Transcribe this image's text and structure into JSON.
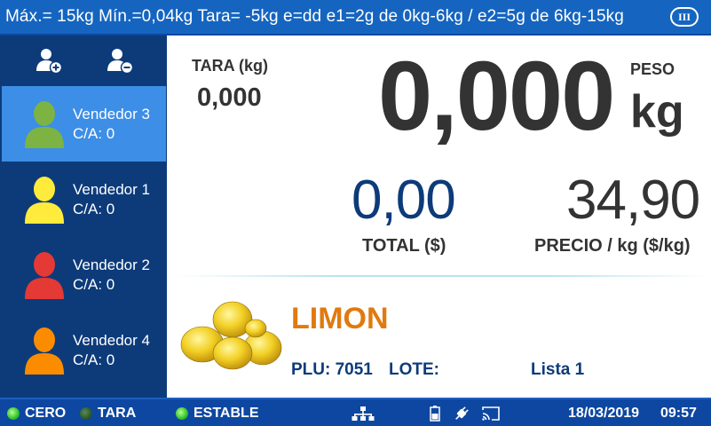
{
  "topbar": {
    "specs": "Máx.= 15kg  Mín.=0,04kg  Tara= -5kg  e=dd  e1=2g de 0kg-6kg / e2=5g de 6kg-15kg",
    "class_badge": "III"
  },
  "sidebar": {
    "actions": [
      {
        "name": "add-vendor",
        "icon": "user-plus-icon"
      },
      {
        "name": "remove-vendor",
        "icon": "user-minus-icon"
      }
    ],
    "vendors": [
      {
        "name": "Vendedor 3",
        "ca": "C/A: 0",
        "color": "#7cb342",
        "active": true
      },
      {
        "name": "Vendedor 1",
        "ca": "C/A: 0",
        "color": "#ffeb3b",
        "active": false
      },
      {
        "name": "Vendedor 2",
        "ca": "C/A: 0",
        "color": "#e53935",
        "active": false
      },
      {
        "name": "Vendedor 4",
        "ca": "C/A: 0",
        "color": "#fb8c00",
        "active": false
      }
    ]
  },
  "main": {
    "tara_label": "TARA (kg)",
    "tara_value": "0,000",
    "weight_value": "0,000",
    "weight_caption": "PESO",
    "weight_unit": "kg",
    "total_value": "0,00",
    "total_label": "TOTAL ($)",
    "price_value": "34,90",
    "price_label": "PRECIO / kg ($/kg)"
  },
  "product": {
    "name": "LIMON",
    "plu": "PLU: 7051",
    "lote": "LOTE:",
    "lista": "Lista 1"
  },
  "status": {
    "cero": "CERO",
    "cero_on": true,
    "tara": "TARA",
    "tara_on": false,
    "estable": "ESTABLE",
    "estable_on": true,
    "date": "18/03/2019",
    "time": "09:57",
    "icons": [
      "network-icon",
      "battery-icon",
      "plug-icon",
      "cast-icon"
    ]
  },
  "colors": {
    "topbar": "#1565c0",
    "sidebar": "#0d3b7a",
    "active_vendor": "#3d8ee6",
    "product_name": "#e07a10",
    "accent_text": "#0d3b7a"
  }
}
